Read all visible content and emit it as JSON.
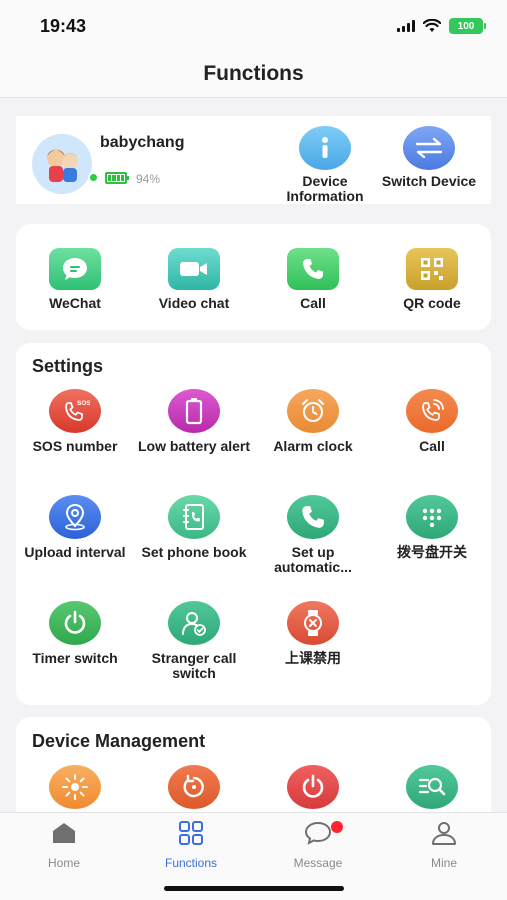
{
  "status_bar": {
    "time": "19:43",
    "battery": "100"
  },
  "nav": {
    "title": "Functions"
  },
  "device": {
    "name": "babychang",
    "battery_percent": "94%",
    "actions": [
      {
        "label": "Device Information",
        "icon": "info-icon"
      },
      {
        "label": "Switch Device",
        "icon": "swap-arrows-icon"
      }
    ]
  },
  "quick_actions": [
    {
      "label": "WeChat",
      "icon": "chat-bubble-icon"
    },
    {
      "label": "Video chat",
      "icon": "video-camera-icon"
    },
    {
      "label": "Call",
      "icon": "phone-icon"
    },
    {
      "label": "QR code",
      "icon": "qr-code-icon"
    }
  ],
  "settings": {
    "title": "Settings",
    "items": [
      {
        "label": "SOS number",
        "icon": "sos-phone-icon"
      },
      {
        "label": "Low battery alert",
        "icon": "battery-icon"
      },
      {
        "label": "Alarm clock",
        "icon": "alarm-clock-icon"
      },
      {
        "label": "Call",
        "icon": "phone-ring-icon"
      },
      {
        "label": "Upload interval",
        "icon": "location-pin-icon"
      },
      {
        "label": "Set phone book",
        "icon": "phone-book-icon"
      },
      {
        "label": "Set up automatic...",
        "icon": "phone-icon"
      },
      {
        "label": "拨号盘开关",
        "icon": "dialpad-icon"
      },
      {
        "label": "Timer switch",
        "icon": "power-icon"
      },
      {
        "label": "Stranger call switch",
        "icon": "person-check-icon"
      },
      {
        "label": "上课禁用",
        "icon": "watch-forbidden-icon"
      }
    ]
  },
  "device_management": {
    "title": "Device Management",
    "items": [
      {
        "icon": "sun-icon"
      },
      {
        "icon": "restart-icon"
      },
      {
        "icon": "power-off-icon"
      },
      {
        "icon": "search-list-icon"
      }
    ]
  },
  "tab_bar": {
    "tabs": [
      {
        "label": "Home",
        "icon": "home-icon",
        "active": false
      },
      {
        "label": "Functions",
        "icon": "grid-icon",
        "active": true
      },
      {
        "label": "Message",
        "icon": "message-icon",
        "active": false,
        "badge": true
      },
      {
        "label": "Mine",
        "icon": "person-icon",
        "active": false
      }
    ]
  },
  "colors": {
    "accent": "#3b6fe0",
    "green": "#3cc46a",
    "red": "#e04a3c",
    "orange": "#f08a2c",
    "purple": "#c937b8",
    "teal": "#3fb59a"
  }
}
